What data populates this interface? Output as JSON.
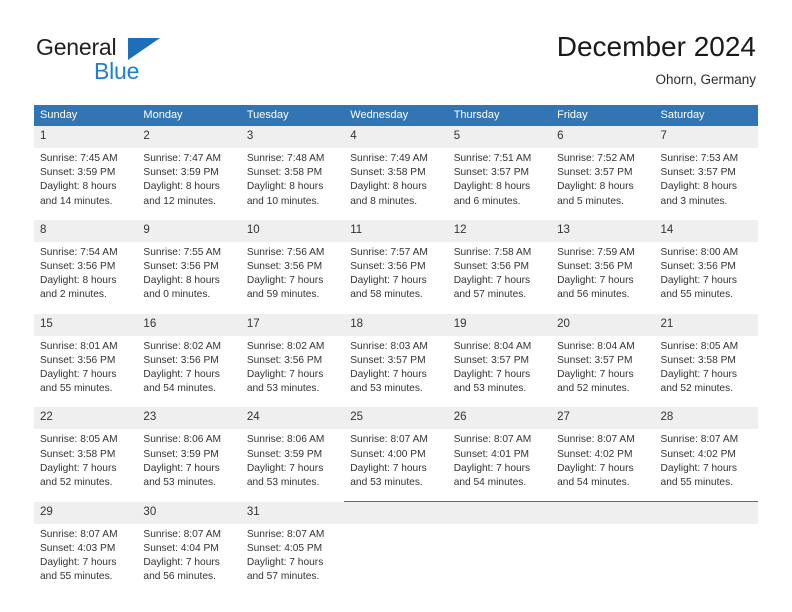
{
  "brand": {
    "name_part1": "General",
    "name_part2": "Blue",
    "sail_color": "#1c6fb8",
    "blue_color": "#1c7fd0"
  },
  "header": {
    "month_title": "December 2024",
    "location": "Ohorn, Germany"
  },
  "theme": {
    "header_blue": "#3275b5",
    "daynum_gray": "#efefef"
  },
  "weekday_headers": [
    "Sunday",
    "Monday",
    "Tuesday",
    "Wednesday",
    "Thursday",
    "Friday",
    "Saturday"
  ],
  "weeks": [
    [
      {
        "day": "1",
        "sunrise": "Sunrise: 7:45 AM",
        "sunset": "Sunset: 3:59 PM",
        "daylight_line1": "Daylight: 8 hours",
        "daylight_line2": "and 14 minutes."
      },
      {
        "day": "2",
        "sunrise": "Sunrise: 7:47 AM",
        "sunset": "Sunset: 3:59 PM",
        "daylight_line1": "Daylight: 8 hours",
        "daylight_line2": "and 12 minutes."
      },
      {
        "day": "3",
        "sunrise": "Sunrise: 7:48 AM",
        "sunset": "Sunset: 3:58 PM",
        "daylight_line1": "Daylight: 8 hours",
        "daylight_line2": "and 10 minutes."
      },
      {
        "day": "4",
        "sunrise": "Sunrise: 7:49 AM",
        "sunset": "Sunset: 3:58 PM",
        "daylight_line1": "Daylight: 8 hours",
        "daylight_line2": "and 8 minutes."
      },
      {
        "day": "5",
        "sunrise": "Sunrise: 7:51 AM",
        "sunset": "Sunset: 3:57 PM",
        "daylight_line1": "Daylight: 8 hours",
        "daylight_line2": "and 6 minutes."
      },
      {
        "day": "6",
        "sunrise": "Sunrise: 7:52 AM",
        "sunset": "Sunset: 3:57 PM",
        "daylight_line1": "Daylight: 8 hours",
        "daylight_line2": "and 5 minutes."
      },
      {
        "day": "7",
        "sunrise": "Sunrise: 7:53 AM",
        "sunset": "Sunset: 3:57 PM",
        "daylight_line1": "Daylight: 8 hours",
        "daylight_line2": "and 3 minutes."
      }
    ],
    [
      {
        "day": "8",
        "sunrise": "Sunrise: 7:54 AM",
        "sunset": "Sunset: 3:56 PM",
        "daylight_line1": "Daylight: 8 hours",
        "daylight_line2": "and 2 minutes."
      },
      {
        "day": "9",
        "sunrise": "Sunrise: 7:55 AM",
        "sunset": "Sunset: 3:56 PM",
        "daylight_line1": "Daylight: 8 hours",
        "daylight_line2": "and 0 minutes."
      },
      {
        "day": "10",
        "sunrise": "Sunrise: 7:56 AM",
        "sunset": "Sunset: 3:56 PM",
        "daylight_line1": "Daylight: 7 hours",
        "daylight_line2": "and 59 minutes."
      },
      {
        "day": "11",
        "sunrise": "Sunrise: 7:57 AM",
        "sunset": "Sunset: 3:56 PM",
        "daylight_line1": "Daylight: 7 hours",
        "daylight_line2": "and 58 minutes."
      },
      {
        "day": "12",
        "sunrise": "Sunrise: 7:58 AM",
        "sunset": "Sunset: 3:56 PM",
        "daylight_line1": "Daylight: 7 hours",
        "daylight_line2": "and 57 minutes."
      },
      {
        "day": "13",
        "sunrise": "Sunrise: 7:59 AM",
        "sunset": "Sunset: 3:56 PM",
        "daylight_line1": "Daylight: 7 hours",
        "daylight_line2": "and 56 minutes."
      },
      {
        "day": "14",
        "sunrise": "Sunrise: 8:00 AM",
        "sunset": "Sunset: 3:56 PM",
        "daylight_line1": "Daylight: 7 hours",
        "daylight_line2": "and 55 minutes."
      }
    ],
    [
      {
        "day": "15",
        "sunrise": "Sunrise: 8:01 AM",
        "sunset": "Sunset: 3:56 PM",
        "daylight_line1": "Daylight: 7 hours",
        "daylight_line2": "and 55 minutes."
      },
      {
        "day": "16",
        "sunrise": "Sunrise: 8:02 AM",
        "sunset": "Sunset: 3:56 PM",
        "daylight_line1": "Daylight: 7 hours",
        "daylight_line2": "and 54 minutes."
      },
      {
        "day": "17",
        "sunrise": "Sunrise: 8:02 AM",
        "sunset": "Sunset: 3:56 PM",
        "daylight_line1": "Daylight: 7 hours",
        "daylight_line2": "and 53 minutes."
      },
      {
        "day": "18",
        "sunrise": "Sunrise: 8:03 AM",
        "sunset": "Sunset: 3:57 PM",
        "daylight_line1": "Daylight: 7 hours",
        "daylight_line2": "and 53 minutes."
      },
      {
        "day": "19",
        "sunrise": "Sunrise: 8:04 AM",
        "sunset": "Sunset: 3:57 PM",
        "daylight_line1": "Daylight: 7 hours",
        "daylight_line2": "and 53 minutes."
      },
      {
        "day": "20",
        "sunrise": "Sunrise: 8:04 AM",
        "sunset": "Sunset: 3:57 PM",
        "daylight_line1": "Daylight: 7 hours",
        "daylight_line2": "and 52 minutes."
      },
      {
        "day": "21",
        "sunrise": "Sunrise: 8:05 AM",
        "sunset": "Sunset: 3:58 PM",
        "daylight_line1": "Daylight: 7 hours",
        "daylight_line2": "and 52 minutes."
      }
    ],
    [
      {
        "day": "22",
        "sunrise": "Sunrise: 8:05 AM",
        "sunset": "Sunset: 3:58 PM",
        "daylight_line1": "Daylight: 7 hours",
        "daylight_line2": "and 52 minutes."
      },
      {
        "day": "23",
        "sunrise": "Sunrise: 8:06 AM",
        "sunset": "Sunset: 3:59 PM",
        "daylight_line1": "Daylight: 7 hours",
        "daylight_line2": "and 53 minutes."
      },
      {
        "day": "24",
        "sunrise": "Sunrise: 8:06 AM",
        "sunset": "Sunset: 3:59 PM",
        "daylight_line1": "Daylight: 7 hours",
        "daylight_line2": "and 53 minutes."
      },
      {
        "day": "25",
        "sunrise": "Sunrise: 8:07 AM",
        "sunset": "Sunset: 4:00 PM",
        "daylight_line1": "Daylight: 7 hours",
        "daylight_line2": "and 53 minutes."
      },
      {
        "day": "26",
        "sunrise": "Sunrise: 8:07 AM",
        "sunset": "Sunset: 4:01 PM",
        "daylight_line1": "Daylight: 7 hours",
        "daylight_line2": "and 54 minutes."
      },
      {
        "day": "27",
        "sunrise": "Sunrise: 8:07 AM",
        "sunset": "Sunset: 4:02 PM",
        "daylight_line1": "Daylight: 7 hours",
        "daylight_line2": "and 54 minutes."
      },
      {
        "day": "28",
        "sunrise": "Sunrise: 8:07 AM",
        "sunset": "Sunset: 4:02 PM",
        "daylight_line1": "Daylight: 7 hours",
        "daylight_line2": "and 55 minutes."
      }
    ],
    [
      {
        "day": "29",
        "sunrise": "Sunrise: 8:07 AM",
        "sunset": "Sunset: 4:03 PM",
        "daylight_line1": "Daylight: 7 hours",
        "daylight_line2": "and 55 minutes."
      },
      {
        "day": "30",
        "sunrise": "Sunrise: 8:07 AM",
        "sunset": "Sunset: 4:04 PM",
        "daylight_line1": "Daylight: 7 hours",
        "daylight_line2": "and 56 minutes."
      },
      {
        "day": "31",
        "sunrise": "Sunrise: 8:07 AM",
        "sunset": "Sunset: 4:05 PM",
        "daylight_line1": "Daylight: 7 hours",
        "daylight_line2": "and 57 minutes."
      },
      {
        "day": "",
        "sunrise": "",
        "sunset": "",
        "daylight_line1": "",
        "daylight_line2": ""
      },
      {
        "day": "",
        "sunrise": "",
        "sunset": "",
        "daylight_line1": "",
        "daylight_line2": ""
      },
      {
        "day": "",
        "sunrise": "",
        "sunset": "",
        "daylight_line1": "",
        "daylight_line2": ""
      },
      {
        "day": "",
        "sunrise": "",
        "sunset": "",
        "daylight_line1": "",
        "daylight_line2": ""
      }
    ]
  ]
}
